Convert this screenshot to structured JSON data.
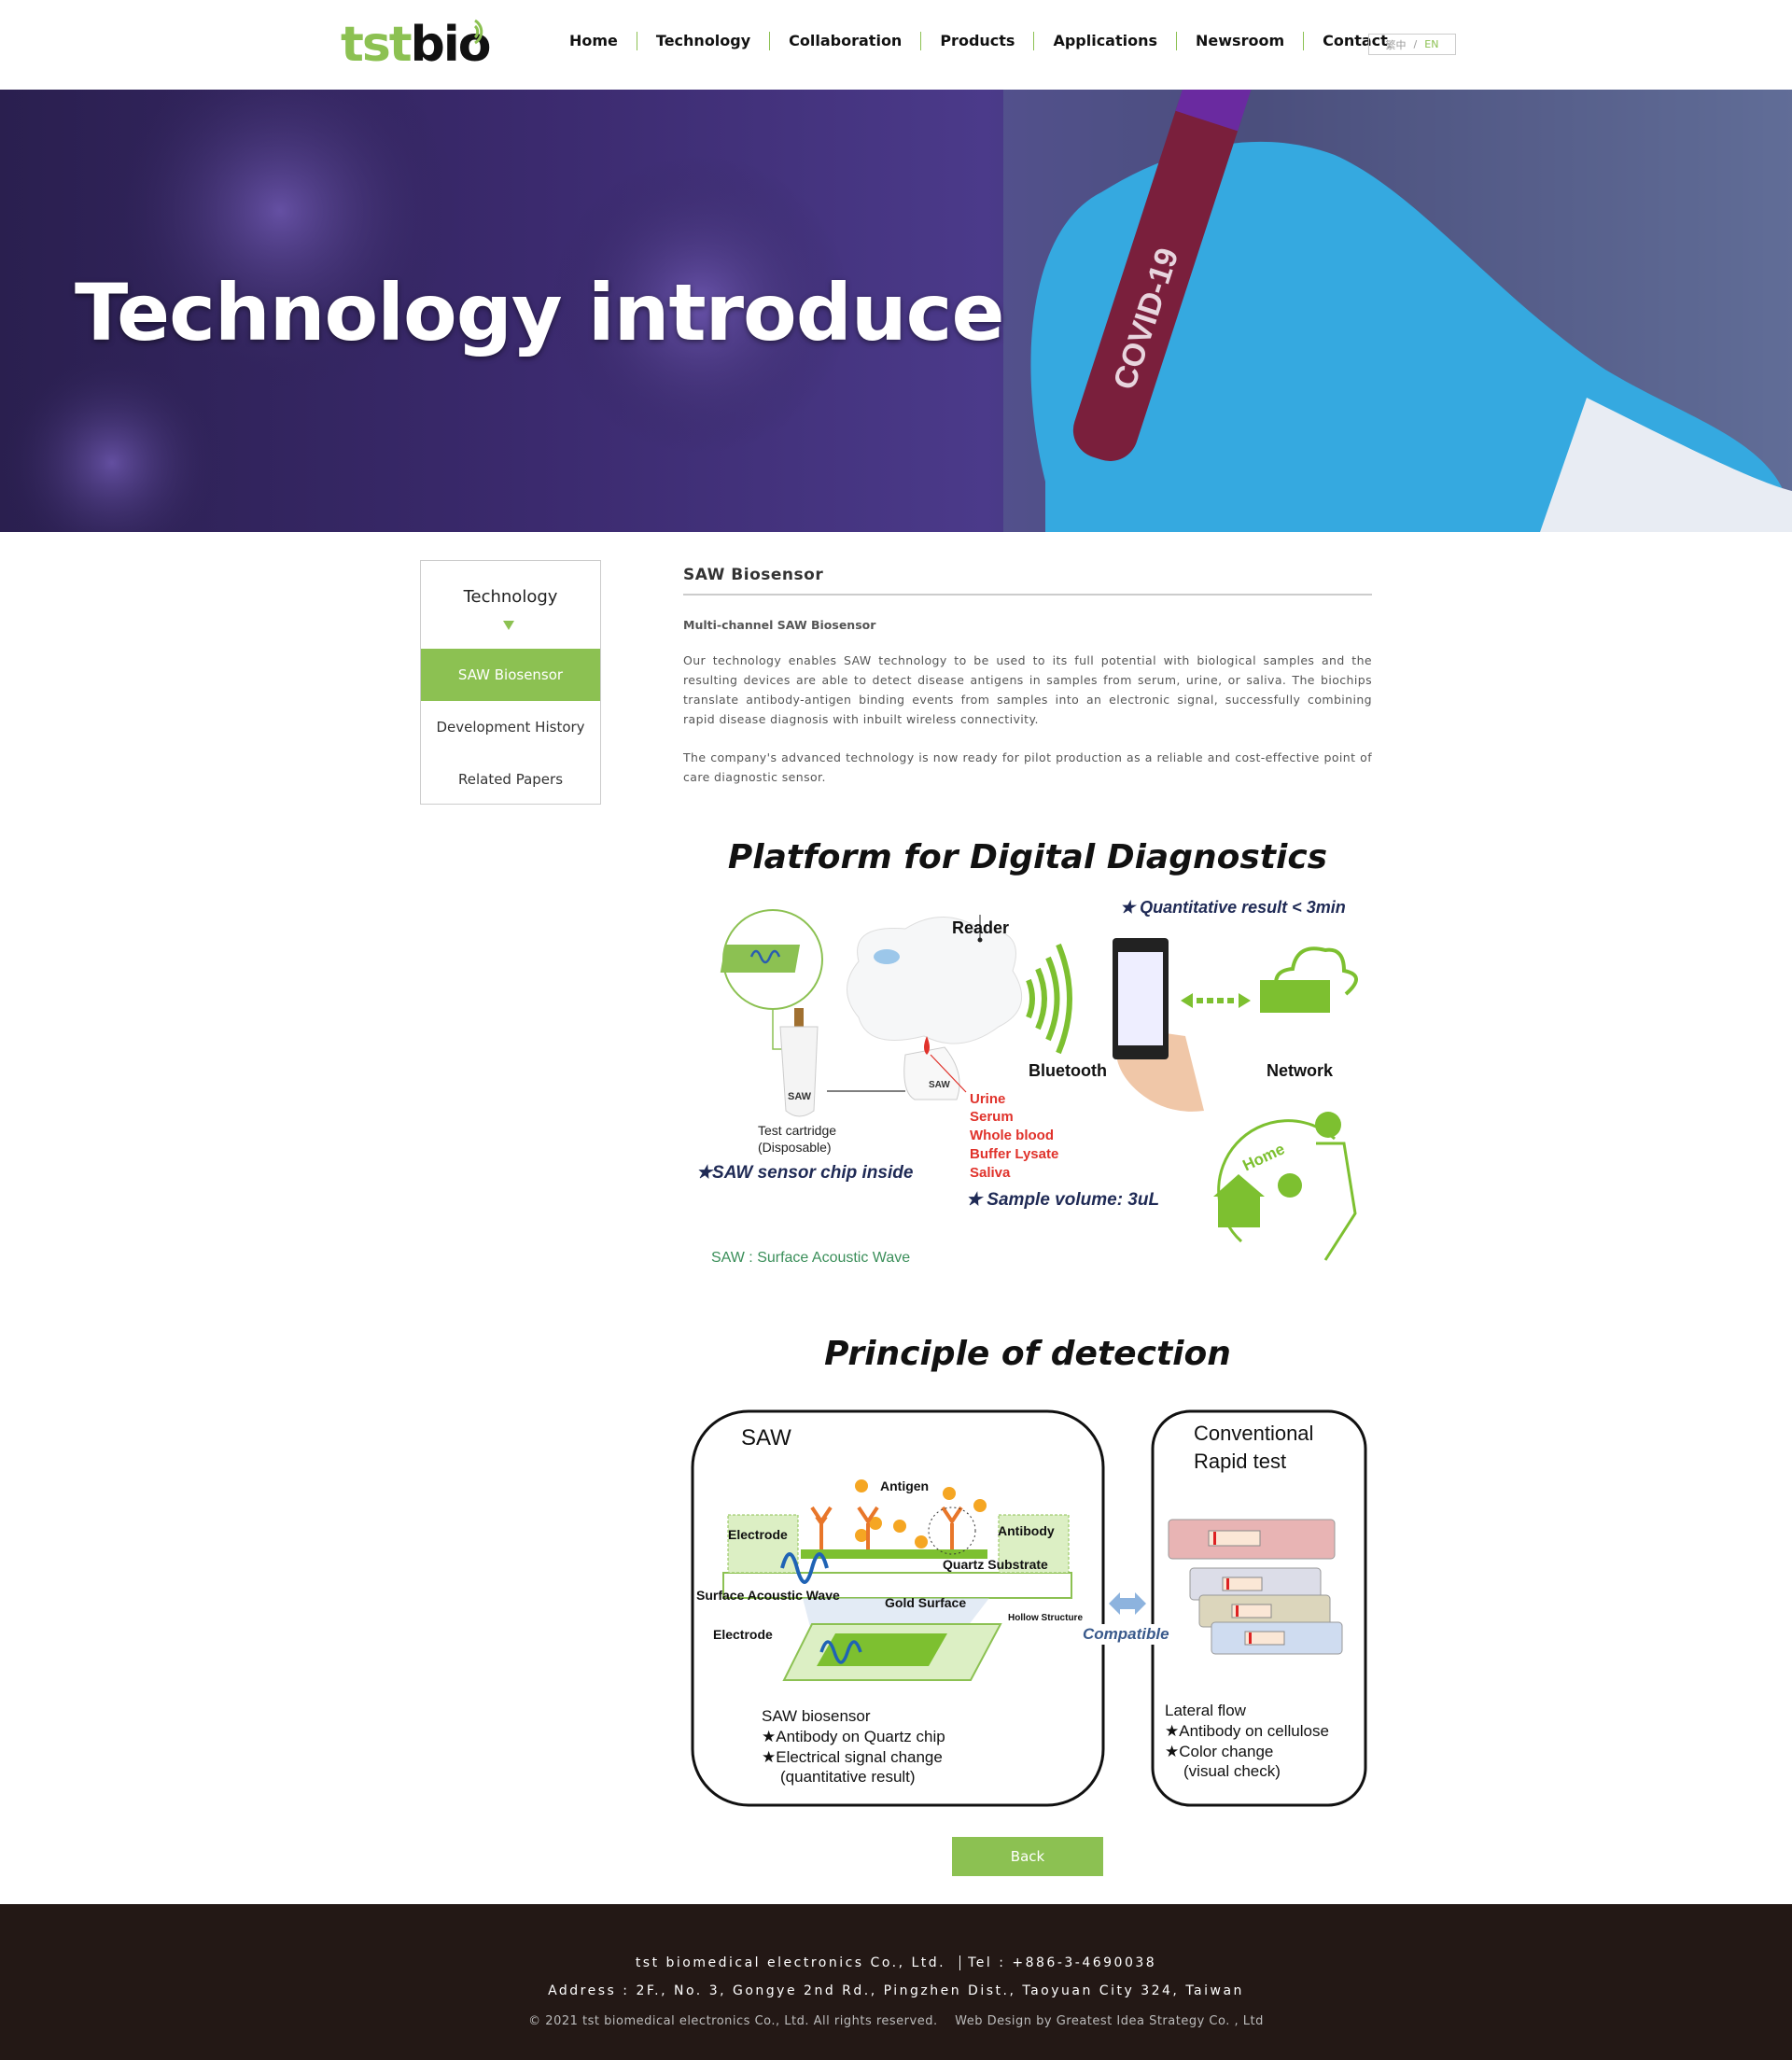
{
  "header": {
    "logo": {
      "part1": "tst",
      "part2": "bio"
    },
    "nav": [
      "Home",
      "Technology",
      "Collaboration",
      "Products",
      "Applications",
      "Newsroom",
      "Contact"
    ],
    "lang": {
      "zh": "繁中",
      "sep": "/",
      "en": "EN"
    }
  },
  "hero": {
    "title": "Technology introduce",
    "tube_label": "COVID-19"
  },
  "sidebar": {
    "title": "Technology",
    "items": [
      {
        "label": "SAW Biosensor",
        "active": true
      },
      {
        "label": "Development History",
        "active": false
      },
      {
        "label": "Related Papers",
        "active": false
      }
    ]
  },
  "main": {
    "title": "SAW Biosensor",
    "subtitle": "Multi-channel SAW Biosensor",
    "paragraphs": [
      "Our technology enables SAW technology to be used to its full potential with biological samples and the resulting devices are able to detect disease antigens in samples from serum, urine, or saliva. The biochips translate antibody-antigen binding events from samples into an electronic signal, successfully combining rapid disease diagnosis with inbuilt wireless connectivity.",
      "The company's advanced technology is now ready for pilot production as a reliable and cost-effective point of care diagnostic sensor."
    ],
    "back_label": "Back"
  },
  "figure1": {
    "title": "Platform for Digital Diagnostics",
    "quantitative": "★ Quantitative result < 3min",
    "reader": "Reader",
    "bluetooth": "Bluetooth",
    "network": "Network",
    "cartridge_1": "Test cartridge",
    "cartridge_2": "(Disposable)",
    "chip_inside": "★SAW sensor chip inside",
    "samples": [
      "Urine",
      "Serum",
      "Whole blood",
      "Buffer Lysate",
      "Saliva"
    ],
    "sample_volume": "★ Sample volume: 3uL",
    "home": "Home",
    "saw_logo": "SAW",
    "footnote": "SAW : Surface Acoustic Wave"
  },
  "figure2": {
    "title": "Principle of detection",
    "saw_title": "SAW",
    "antigen": "Antigen",
    "antibody": "Antibody",
    "electrode": "Electrode",
    "quartz": "Quartz Substrate",
    "saw_wave": "Surface Acoustic Wave",
    "gold": "Gold Surface",
    "hollow": "Hollow Structure",
    "compatible": "Compatible",
    "saw_desc": [
      "SAW biosensor",
      "★Antibody on Quartz chip",
      "★Electrical signal change",
      "(quantitative result)"
    ],
    "conv_title": [
      "Conventional",
      "Rapid test"
    ],
    "conv_desc": [
      "Lateral flow",
      "★Antibody on cellulose",
      "★Color change",
      "(visual check)"
    ]
  },
  "footer": {
    "company": "tst biomedical electronics Co., Ltd.",
    "tel": "Tel : +886-3-4690038",
    "address": "Address : 2F., No. 3, Gongye 2nd Rd., Pingzhen Dist., Taoyuan City 324, Taiwan",
    "copyright": "© 2021 tst biomedical electronics Co., Ltd. All rights reserved.",
    "design": "Web Design by Greatest Idea Strategy Co. , Ltd"
  },
  "colors": {
    "accent": "#8cc152",
    "footer_bg": "#231815",
    "sample_red": "#e0322b",
    "navy_text": "#1f2a55"
  }
}
